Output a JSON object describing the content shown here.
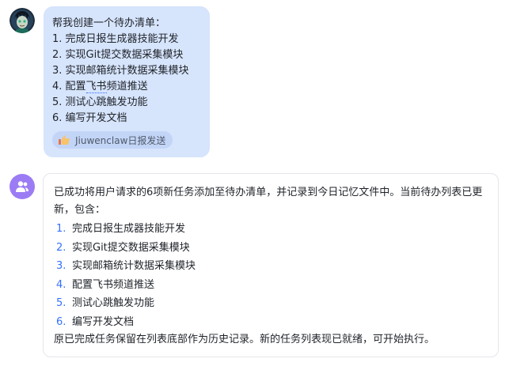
{
  "user_message": {
    "lines": [
      "帮我创建一个待办清单：",
      "1. 完成日报生成器技能开发",
      "2. 实现Git提交数据采集模块",
      "3. 实现邮箱统计数据采集模块",
      "4. 配置飞书频道推送",
      "5. 测试心跳触发功能",
      "6. 编写开发文档"
    ],
    "line4_prefix": "4. 配置",
    "line4_marked": "飞书",
    "line4_suffix": "频道推送",
    "reference_tag": "Jiuwenclaw日报发送",
    "reference_icon": "thumbs-up-icon",
    "colors": {
      "bubble": "#d6e4fc",
      "tag": "#c3d5f7"
    }
  },
  "bot_message": {
    "avatar_icon": "group-users-icon",
    "intro": "已成功将用户请求的6项新任务添加至待办清单，并记录到今日记忆文件中。当前待办列表已更新，包含：",
    "items": [
      {
        "num": "1.",
        "text": "完成日报生成器技能开发"
      },
      {
        "num": "2.",
        "text": "实现Git提交数据采集模块"
      },
      {
        "num": "3.",
        "text": "实现邮箱统计数据采集模块"
      },
      {
        "num": "4.",
        "text": "配置飞书频道推送"
      },
      {
        "num": "5.",
        "text": "测试心跳触发功能"
      },
      {
        "num": "6.",
        "text": "编写开发文档"
      }
    ],
    "outro": "原已完成任务保留在列表底部作为历史记录。新的任务列表现已就绪，可开始执行。",
    "colors": {
      "avatar": "#9b7cf4",
      "number": "#3370ff",
      "border": "#e5e6eb"
    }
  }
}
